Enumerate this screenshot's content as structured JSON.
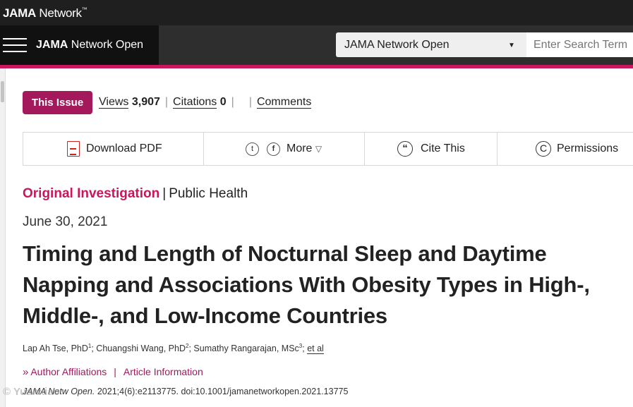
{
  "network_bar": {
    "logo_bold": "JAMA",
    "logo_rest": " Network",
    "tm": "™"
  },
  "journal_bar": {
    "brand_bold": "JAMA",
    "brand_rest": " Network Open",
    "select_value": "JAMA Network Open",
    "search_placeholder": "Enter Search Term"
  },
  "issue_row": {
    "this_issue_label": "This Issue",
    "views_label": "Views",
    "views_count": "3,907",
    "citations_label": "Citations",
    "citations_count": "0",
    "comments_label": "Comments"
  },
  "toolbar": {
    "download_pdf": "Download PDF",
    "more": "More",
    "cite_this": "Cite This",
    "permissions": "Permissions"
  },
  "article": {
    "category_primary": "Original Investigation",
    "category_secondary": "Public Health",
    "date": "June 30, 2021",
    "title": "Timing and Length of Nocturnal Sleep and Daytime Napping and Associations With Obesity Types in High-, Middle-, and Low-Income Countries",
    "author1": "Lap Ah Tse, PhD",
    "author1_sup": "1",
    "author2": "Chuangshi Wang, PhD",
    "author2_sup": "2",
    "author3": "Sumathy Rangarajan, MSc",
    "author3_sup": "3",
    "et_al": "et al",
    "author_affiliations": "Author Affiliations",
    "article_information": "Article Information",
    "citation_journal": "JAMA Netw Open.",
    "citation_rest": " 2021;4(6):e2113775. doi:10.1001/jamanetworkopen.2021.13775"
  },
  "watermark": "© Yuanxiao",
  "colors": {
    "accent": "#c8175d",
    "issue_badge": "#a3195b",
    "header_dark": "#1f1f1f"
  }
}
